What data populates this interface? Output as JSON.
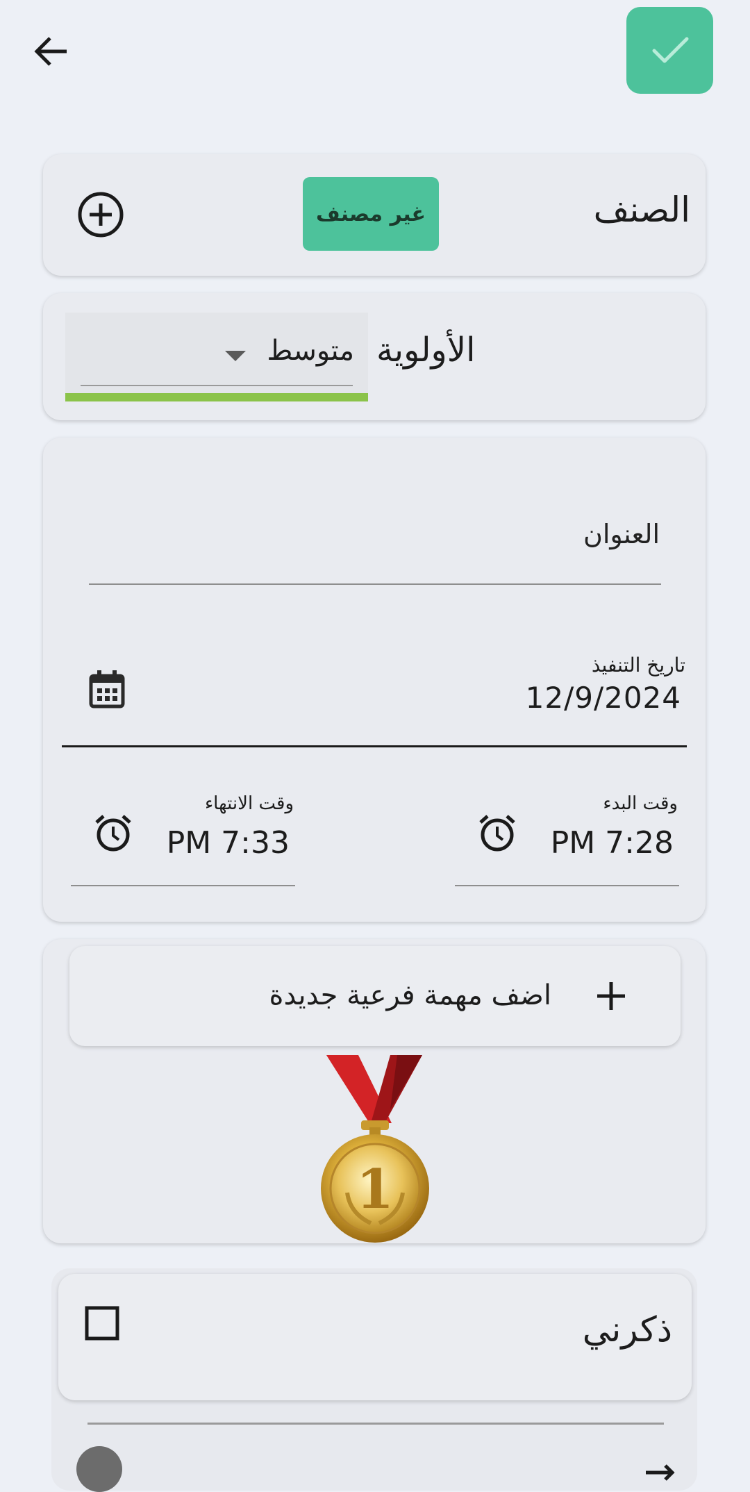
{
  "topbar": {
    "back_icon": "arrow-left-icon",
    "save_icon": "check-icon",
    "accent_color": "#4dc29b"
  },
  "category": {
    "label": "الصنف",
    "chip_text": "غير مصنف",
    "add_icon": "add-circle-icon"
  },
  "priority": {
    "label": "الأولوية",
    "selected": "متوسط",
    "bar_color": "#8bc34a",
    "dropdown_icon": "dropdown-arrow-icon"
  },
  "task": {
    "title_placeholder": "العنوان",
    "date_label": "تاريخ التنفيذ",
    "date_value": "12/9/2024",
    "calendar_icon": "calendar-icon",
    "start_label": "وقت البدء",
    "start_value": "PM 7:28",
    "end_label": "وقت الانتهاء",
    "end_value": "PM 7:33",
    "alarm_icon": "alarm-clock-icon"
  },
  "subtasks": {
    "add_label": "اضف مهمة فرعية جديدة",
    "plus_icon": "plus-icon",
    "medal_icon": "gold-medal-icon",
    "medal_number": "1"
  },
  "reminder": {
    "label": "ذكرني",
    "checked": false,
    "checkbox_icon": "checkbox-icon"
  }
}
